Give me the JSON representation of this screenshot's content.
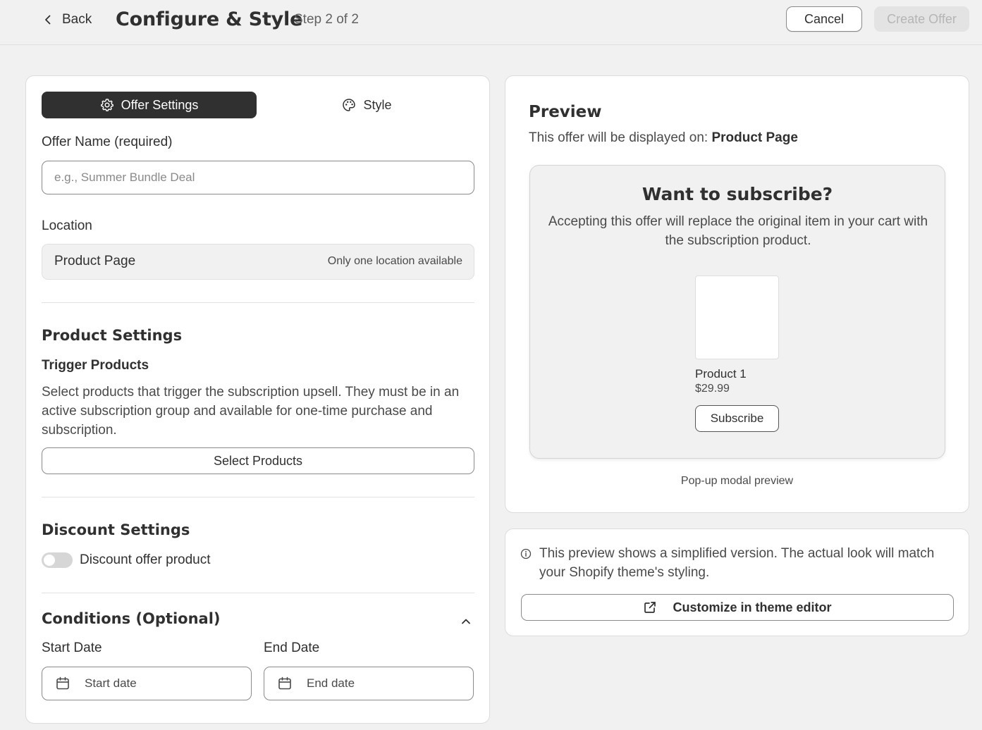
{
  "header": {
    "back_label": "Back",
    "title": "Configure & Style",
    "step": "Step 2 of 2",
    "cancel_label": "Cancel",
    "create_label": "Create Offer"
  },
  "tabs": {
    "offer_settings": "Offer Settings",
    "style": "Style"
  },
  "form": {
    "offer_name_label": "Offer Name (required)",
    "offer_name_placeholder": "e.g., Summer Bundle Deal",
    "location_label": "Location",
    "location_value": "Product Page",
    "location_note": "Only one location available",
    "product_settings_heading": "Product Settings",
    "trigger_products_heading": "Trigger Products",
    "trigger_products_desc": "Select products that trigger the subscription upsell. They must be in an active subscription group and available for one-time purchase and subscription.",
    "select_products_label": "Select Products",
    "discount_settings_heading": "Discount Settings",
    "discount_toggle_label": "Discount offer product",
    "discount_enabled": false,
    "conditions_heading": "Conditions (Optional)",
    "start_date_label": "Start Date",
    "start_date_placeholder": "Start date",
    "end_date_label": "End Date",
    "end_date_placeholder": "End date"
  },
  "preview": {
    "heading": "Preview",
    "displayed_on_prefix": "This offer will be displayed on: ",
    "displayed_on_value": "Product Page",
    "modal_title": "Want to subscribe?",
    "modal_text": "Accepting this offer will replace the original item in your cart with the subscription product.",
    "product_name": "Product 1",
    "product_price": "$29.99",
    "subscribe_label": "Subscribe",
    "caption": "Pop-up modal preview"
  },
  "info": {
    "note": "This preview shows a simplified version. The actual look will match your Shopify theme's styling.",
    "customize_label": "Customize in theme editor"
  },
  "icons": {
    "back": "chevron-left-icon",
    "settings": "gear-icon",
    "style": "palette-icon",
    "collapse": "chevron-up-icon",
    "calendar": "calendar-icon",
    "info": "info-icon",
    "external": "external-link-icon"
  }
}
